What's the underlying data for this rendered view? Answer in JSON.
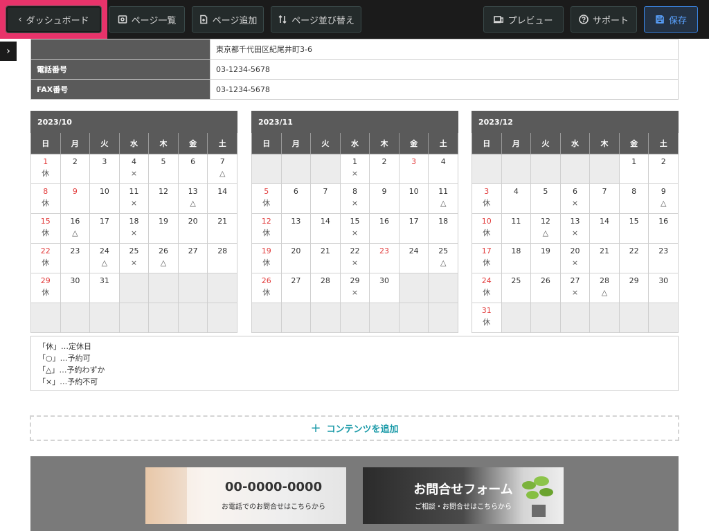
{
  "toolbar": {
    "dashboard": "ダッシュボード",
    "page_list": "ページ一覧",
    "page_add": "ページ追加",
    "page_sort": "ページ並び替え",
    "preview": "プレビュー",
    "support": "サポート",
    "save": "保存"
  },
  "info": {
    "address_value": "東京都千代田区紀尾井町3-6",
    "phone_label": "電話番号",
    "phone_value": "03-1234-5678",
    "fax_label": "FAX番号",
    "fax_value": "03-1234-5678"
  },
  "weekday_headers": [
    "日",
    "月",
    "火",
    "水",
    "木",
    "金",
    "土"
  ],
  "calendars": [
    {
      "title": "2023/10",
      "rows": [
        [
          {
            "d": "1",
            "red": true,
            "m": "休"
          },
          {
            "d": "2",
            "m": ""
          },
          {
            "d": "3",
            "m": ""
          },
          {
            "d": "4",
            "m": "×"
          },
          {
            "d": "5",
            "m": ""
          },
          {
            "d": "6",
            "m": ""
          },
          {
            "d": "7",
            "m": "△"
          }
        ],
        [
          {
            "d": "8",
            "red": true,
            "m": "休"
          },
          {
            "d": "9",
            "red": true,
            "m": ""
          },
          {
            "d": "10",
            "m": ""
          },
          {
            "d": "11",
            "m": "×"
          },
          {
            "d": "12",
            "m": ""
          },
          {
            "d": "13",
            "m": "△"
          },
          {
            "d": "14",
            "m": ""
          }
        ],
        [
          {
            "d": "15",
            "red": true,
            "m": "休"
          },
          {
            "d": "16",
            "m": "△"
          },
          {
            "d": "17",
            "m": ""
          },
          {
            "d": "18",
            "m": "×"
          },
          {
            "d": "19",
            "m": ""
          },
          {
            "d": "20",
            "m": ""
          },
          {
            "d": "21",
            "m": ""
          }
        ],
        [
          {
            "d": "22",
            "red": true,
            "m": "休"
          },
          {
            "d": "23",
            "m": ""
          },
          {
            "d": "24",
            "m": "△"
          },
          {
            "d": "25",
            "m": "×"
          },
          {
            "d": "26",
            "m": "△"
          },
          {
            "d": "27",
            "m": ""
          },
          {
            "d": "28",
            "m": ""
          }
        ],
        [
          {
            "d": "29",
            "red": true,
            "m": "休"
          },
          {
            "d": "30",
            "m": ""
          },
          {
            "d": "31",
            "m": ""
          },
          null,
          null,
          null,
          null
        ],
        [
          null,
          null,
          null,
          null,
          null,
          null,
          null
        ]
      ]
    },
    {
      "title": "2023/11",
      "rows": [
        [
          null,
          null,
          null,
          {
            "d": "1",
            "m": "×"
          },
          {
            "d": "2",
            "m": ""
          },
          {
            "d": "3",
            "red": true,
            "m": ""
          },
          {
            "d": "4",
            "m": ""
          }
        ],
        [
          {
            "d": "5",
            "red": true,
            "m": "休"
          },
          {
            "d": "6",
            "m": ""
          },
          {
            "d": "7",
            "m": ""
          },
          {
            "d": "8",
            "m": "×"
          },
          {
            "d": "9",
            "m": ""
          },
          {
            "d": "10",
            "m": ""
          },
          {
            "d": "11",
            "m": "△"
          }
        ],
        [
          {
            "d": "12",
            "red": true,
            "m": "休"
          },
          {
            "d": "13",
            "m": ""
          },
          {
            "d": "14",
            "m": ""
          },
          {
            "d": "15",
            "m": "×"
          },
          {
            "d": "16",
            "m": ""
          },
          {
            "d": "17",
            "m": ""
          },
          {
            "d": "18",
            "m": ""
          }
        ],
        [
          {
            "d": "19",
            "red": true,
            "m": "休"
          },
          {
            "d": "20",
            "m": ""
          },
          {
            "d": "21",
            "m": ""
          },
          {
            "d": "22",
            "m": "×"
          },
          {
            "d": "23",
            "red": true,
            "m": ""
          },
          {
            "d": "24",
            "m": ""
          },
          {
            "d": "25",
            "m": "△"
          }
        ],
        [
          {
            "d": "26",
            "red": true,
            "m": "休"
          },
          {
            "d": "27",
            "m": ""
          },
          {
            "d": "28",
            "m": ""
          },
          {
            "d": "29",
            "m": "×"
          },
          {
            "d": "30",
            "m": ""
          },
          null,
          null
        ],
        [
          null,
          null,
          null,
          null,
          null,
          null,
          null
        ]
      ]
    },
    {
      "title": "2023/12",
      "rows": [
        [
          null,
          null,
          null,
          null,
          null,
          {
            "d": "1",
            "m": ""
          },
          {
            "d": "2",
            "m": ""
          }
        ],
        [
          {
            "d": "3",
            "red": true,
            "m": "休"
          },
          {
            "d": "4",
            "m": ""
          },
          {
            "d": "5",
            "m": ""
          },
          {
            "d": "6",
            "m": "×"
          },
          {
            "d": "7",
            "m": ""
          },
          {
            "d": "8",
            "m": ""
          },
          {
            "d": "9",
            "m": "△"
          }
        ],
        [
          {
            "d": "10",
            "red": true,
            "m": "休"
          },
          {
            "d": "11",
            "m": ""
          },
          {
            "d": "12",
            "m": "△"
          },
          {
            "d": "13",
            "m": "×"
          },
          {
            "d": "14",
            "m": ""
          },
          {
            "d": "15",
            "m": ""
          },
          {
            "d": "16",
            "m": ""
          }
        ],
        [
          {
            "d": "17",
            "red": true,
            "m": "休"
          },
          {
            "d": "18",
            "m": ""
          },
          {
            "d": "19",
            "m": ""
          },
          {
            "d": "20",
            "m": "×"
          },
          {
            "d": "21",
            "m": ""
          },
          {
            "d": "22",
            "m": ""
          },
          {
            "d": "23",
            "m": ""
          }
        ],
        [
          {
            "d": "24",
            "red": true,
            "m": "休"
          },
          {
            "d": "25",
            "m": ""
          },
          {
            "d": "26",
            "m": ""
          },
          {
            "d": "27",
            "m": "×"
          },
          {
            "d": "28",
            "m": "△"
          },
          {
            "d": "29",
            "m": ""
          },
          {
            "d": "30",
            "m": ""
          }
        ],
        [
          {
            "d": "31",
            "red": true,
            "m": "休"
          },
          null,
          null,
          null,
          null,
          null,
          null
        ]
      ]
    }
  ],
  "legend": [
    "「休」…定休日",
    "「○」…予約可",
    "「△」…予約わずか",
    "「×」…予約不可"
  ],
  "add_content": "コンテンツを追加",
  "footer": {
    "phone_big": "00-0000-0000",
    "phone_small": "お電話でのお問合せはこちらから",
    "form_big": "お問合せフォーム",
    "form_small": "ご相談・お問合せはこちらから"
  },
  "colors": {
    "highlight": "#e8336a",
    "save_accent": "#3a86e6",
    "sunday_red": "#e23b3b",
    "add_teal": "#1a9aa8"
  }
}
